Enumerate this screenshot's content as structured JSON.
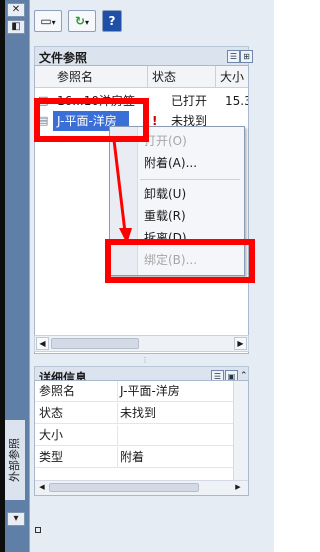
{
  "strip": {
    "close_glyph": "✕",
    "title": "外部参照"
  },
  "toolbar": {
    "attach_glyph": "▭",
    "refresh_glyph": "↻",
    "help_label": "?"
  },
  "file_refs": {
    "title": "文件参照",
    "columns": [
      "参照名",
      "状态",
      "大小"
    ],
    "rows": [
      {
        "name": "16...10洋房笠",
        "status": "已打开",
        "size": "15.3"
      },
      {
        "name": "J-平面-洋房",
        "status": "未找到",
        "size": ""
      }
    ],
    "warning_glyph": "!"
  },
  "context_menu": {
    "items": [
      {
        "label": "打开(O)",
        "disabled": true
      },
      {
        "label": "附着(A)...",
        "disabled": false
      },
      {
        "label": "卸载(U)",
        "disabled": false
      },
      {
        "label": "重载(R)",
        "disabled": false
      },
      {
        "label": "拆离(D)",
        "disabled": false
      },
      {
        "label": "绑定(B)...",
        "disabled": true
      }
    ]
  },
  "details": {
    "title": "详细信息",
    "rows": [
      {
        "label": "参照名",
        "value": "J-平面-洋房"
      },
      {
        "label": "状态",
        "value": "未找到"
      },
      {
        "label": "大小",
        "value": ""
      },
      {
        "label": "类型",
        "value": "附着"
      }
    ]
  },
  "colors": {
    "highlight": "#ff0000",
    "selection": "#3a6fd8"
  }
}
